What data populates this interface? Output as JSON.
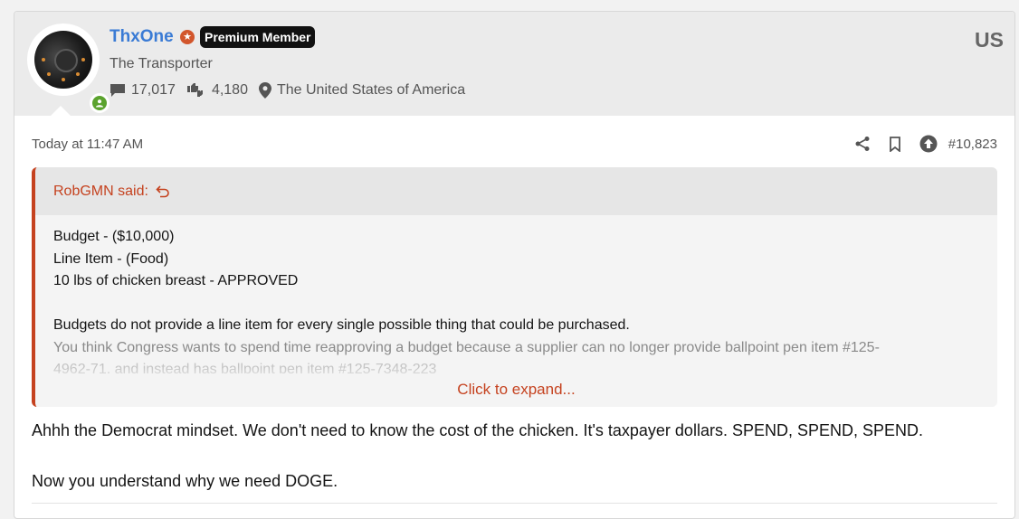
{
  "user": {
    "name": "ThxOne",
    "badge": "Premium Member",
    "title": "The Transporter",
    "messages": "17,017",
    "reactions": "4,180",
    "location": "The United States of America",
    "country_code": "US",
    "icons": {
      "messages": "comment-icon",
      "reactions": "thumbs-icon",
      "location": "map-pin-icon",
      "status": "online-user-icon",
      "rank": "star-icon"
    }
  },
  "post": {
    "date": "Today at 11:47 AM",
    "number": "#10,823",
    "actions": [
      "share-icon",
      "bookmark-icon",
      "upvote-icon"
    ]
  },
  "quote": {
    "author": "RobGMN said:",
    "lines": [
      "Budget - ($10,000)",
      "Line Item - (Food)",
      "10 lbs of chicken breast - APPROVED",
      "Budgets do not provide a line item for every single possible thing that could be purchased.",
      "You think Congress wants to spend time reapproving a budget because a supplier can no longer provide ballpoint pen item #125-",
      "4962-71, and instead has ballpoint pen item #125-7348-223"
    ],
    "expand_label": "Click to expand..."
  },
  "message": {
    "paragraphs": [
      "Ahhh the Democrat mindset. We don't need to know the cost of the chicken. It's taxpayer dollars. SPEND, SPEND, SPEND.",
      "Now you understand why we need DOGE."
    ]
  },
  "colors": {
    "username": "#3a7bd5",
    "accent": "#c5421f",
    "online": "#5ba32e",
    "header_bg": "#ebebeb"
  }
}
